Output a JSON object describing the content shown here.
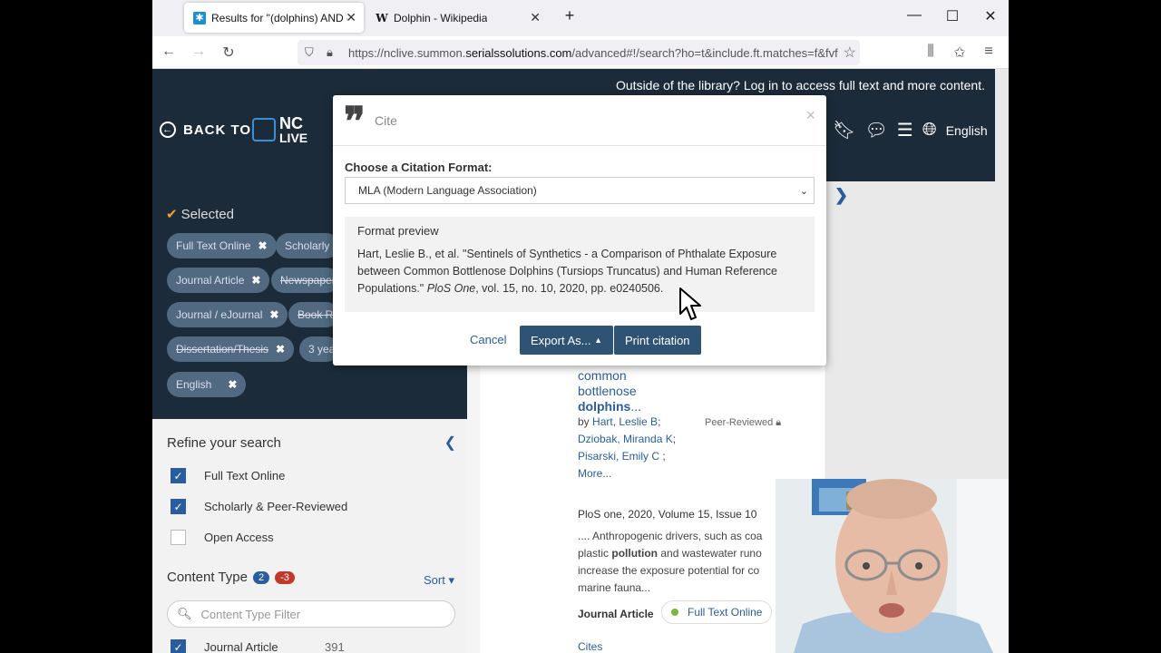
{
  "browser": {
    "tabs": [
      {
        "title": "Results for \"(dolphins) AND (pc",
        "favicon": "summon-icon",
        "active": true
      },
      {
        "title": "Dolphin - Wikipedia",
        "favicon": "wikipedia-w-icon",
        "active": false
      }
    ],
    "new_tab": "+",
    "url_prefix": "https://nclive.summon.",
    "url_domain": "serialssolutions.com",
    "url_suffix": "/advanced#!/search?ho=t&include.ft.matches=f&fvf=",
    "wikipedia_glyph": "W"
  },
  "header": {
    "login_text": "Outside of the library? Log in to access full text and more content.",
    "back_label": "BACK TO",
    "logo_text_1": "NC",
    "logo_text_2": "LIVE",
    "language": "English"
  },
  "selected": {
    "heading": "Selected",
    "chips": [
      {
        "label": "Full Text Online",
        "struck": false
      },
      {
        "label": "Scholarly &",
        "struck": false
      },
      {
        "label": "Journal Article",
        "struck": false
      },
      {
        "label": "Newspaper",
        "struck": true
      },
      {
        "label": "Journal / eJournal",
        "struck": false
      },
      {
        "label": "Book Re",
        "struck": true
      },
      {
        "label": "Dissertation/Thesis",
        "struck": true
      },
      {
        "label": "3 yea",
        "struck": false
      },
      {
        "label": "English",
        "struck": false
      }
    ]
  },
  "refine": {
    "title": "Refine your search",
    "facets": [
      {
        "label": "Full Text Online",
        "checked": true
      },
      {
        "label": "Scholarly & Peer-Reviewed",
        "checked": true
      },
      {
        "label": "Open Access",
        "checked": false
      }
    ],
    "content_type_label": "Content Type",
    "badge_include": "2",
    "badge_exclude": "-3",
    "sort_label": "Sort",
    "filter_placeholder": "Content Type Filter",
    "journal_article_label": "Journal Article",
    "journal_article_count": "391"
  },
  "result": {
    "title_plain_1": "common",
    "title_plain_2": "bottlenose",
    "title_bold": "dolphins",
    "title_ellipsis": "...",
    "by_label": "by",
    "authors": [
      "Hart, Leslie B",
      "Dziobak, Miranda K",
      "Pisarski, Emily C"
    ],
    "more": "More...",
    "peer_reviewed": "Peer-Reviewed",
    "source": "PloS one, 2020, Volume 15, Issue 10",
    "snippet_1": ".... Anthropogenic drivers, such as coa",
    "snippet_2a": "plastic ",
    "snippet_2b": "pollution",
    "snippet_2c": " and wastewater runo",
    "snippet_3": "increase the exposure potential for co",
    "snippet_4": "marine fauna...",
    "type": "Journal Article",
    "fto": "Full Text Online",
    "cites": "Cites"
  },
  "modal": {
    "title": "Cite",
    "close": "×",
    "format_label": "Choose a Citation Format:",
    "format_value": "MLA (Modern Language Association)",
    "preview_heading": "Format preview",
    "citation_pre": "Hart, Leslie B., et al. \"Sentinels of Synthetics - a Comparison of Phthalate Exposure between Common Bottlenose Dolphins (Tursiops Truncatus) and Human Reference Populations.\" ",
    "citation_journal": "PloS One",
    "citation_post": ", vol. 15, no. 10, 2020, pp. e0240506.",
    "cancel": "Cancel",
    "export": "Export As...",
    "print": "Print citation"
  },
  "colors": {
    "header_bg": "#1c2b3a",
    "accent": "#2a5d9f",
    "button_bg": "#2e5374",
    "badge_blue": "#2a5d9f",
    "badge_red": "#c0392b"
  }
}
